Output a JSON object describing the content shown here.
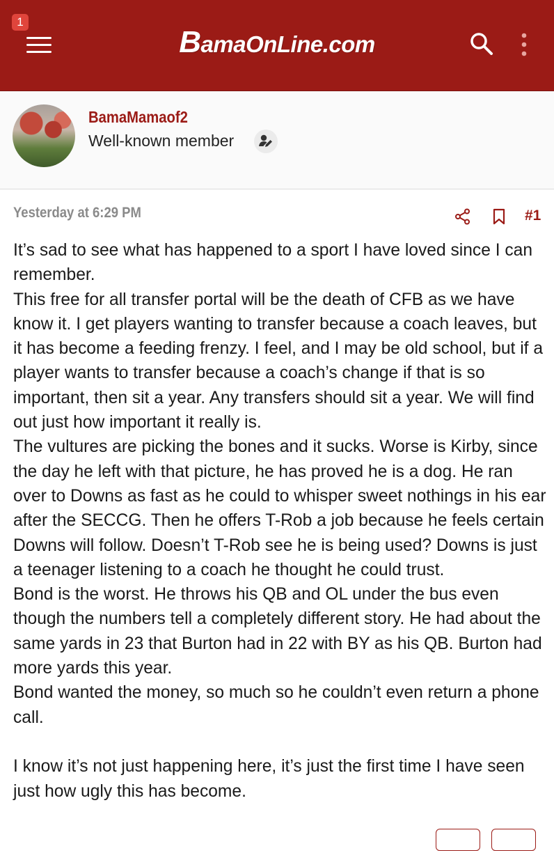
{
  "header": {
    "notification_count": "1",
    "logo_text": "BamaOnLine.com",
    "logo_initial": "B",
    "logo_rest": "amaOnLine.com",
    "menu_icon": "hamburger-icon",
    "search_icon": "search-icon",
    "more_icon": "vertical-dots-icon",
    "bg_color": "#9b1b16"
  },
  "member": {
    "username": "BamaMamaof2",
    "title": "Well-known member",
    "badge_icon": "user-edit-icon"
  },
  "post": {
    "date": "Yesterday at 6:29 PM",
    "number": "#1",
    "share_icon": "share-icon",
    "bookmark_icon": "bookmark-icon",
    "paragraphs": [
      "It’s sad to see what has happened to a sport I have loved since I can remember.",
      "This free for all transfer portal will be the death of CFB as we have know it. I get players wanting to transfer because a coach leaves, but it has become a feeding frenzy. I feel, and I may be old school, but if a player wants to transfer because a coach’s change if that is so important, then sit a year. Any transfers should sit a year. We will find out just how important it really is.",
      "The vultures are picking the bones and it sucks. Worse is Kirby, since the day he left with that picture, he has proved he is a dog. He ran over to Downs as fast as he could to whisper sweet nothings in his ear after the SECCG. Then he offers T-Rob a job because he feels certain Downs will follow. Doesn’t T-Rob see he is being used? Downs is just a teenager listening to a coach he thought he could trust.",
      "Bond is the worst. He throws his QB and OL under the bus even though the numbers tell a completely different story. He had about the same yards in 23 that Burton had in 22 with BY as his QB. Burton had more yards this year.",
      "Bond wanted the money, so much so he couldn’t even return a phone call.",
      "",
      "I know it’s not just happening here, it’s just the first time I have seen just how ugly this has become."
    ]
  }
}
